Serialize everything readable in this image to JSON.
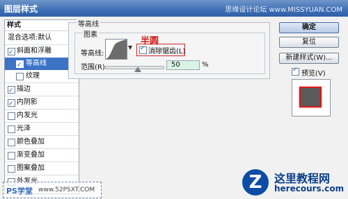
{
  "window": {
    "title": "图层样式",
    "watermark": "思缘设计论坛 www.MISSYUAN.COM"
  },
  "sidebar": {
    "header": "样式",
    "items": [
      {
        "label": "混合选项:默认",
        "checkbox": false
      },
      {
        "label": "斜面和浮雕",
        "checkbox": true,
        "checked": true
      },
      {
        "label": "等高线",
        "checkbox": true,
        "checked": true
      },
      {
        "label": "纹理",
        "checkbox": true,
        "checked": false
      },
      {
        "label": "描边",
        "checkbox": true,
        "checked": true
      },
      {
        "label": "内阴影",
        "checkbox": true,
        "checked": true
      },
      {
        "label": "内发光",
        "checkbox": true,
        "checked": false
      },
      {
        "label": "光泽",
        "checkbox": true,
        "checked": false
      },
      {
        "label": "颜色叠加",
        "checkbox": true,
        "checked": false
      },
      {
        "label": "渐变叠加",
        "checkbox": true,
        "checked": false
      },
      {
        "label": "图案叠加",
        "checkbox": true,
        "checked": false
      },
      {
        "label": "外发光",
        "checkbox": true,
        "checked": false
      }
    ]
  },
  "panel": {
    "group_title": "等高线",
    "sub_title": "图素",
    "contour_label": "等高线:",
    "antialias_label": "消除锯齿(L)",
    "antialias_checked": true,
    "annotation": "半圆",
    "range_label": "范围(R):",
    "range_value": "50",
    "range_unit": "%",
    "range_fraction": 0.5
  },
  "buttons": {
    "ok": "确定",
    "reset": "复位",
    "new_style": "新建样式(W)...",
    "preview": "预览(V)",
    "preview_checked": true
  },
  "watermarks": {
    "brand_name": "这里教程网",
    "brand_url": "herecours.com",
    "brand_letter": "Z",
    "bottom_left": "PS学堂",
    "bottom_left_url": "www.52PSXT.COM"
  },
  "colors": {
    "accent": "#3c73c6",
    "annotation": "#d01818",
    "swatch_border": "#d51b1b"
  }
}
